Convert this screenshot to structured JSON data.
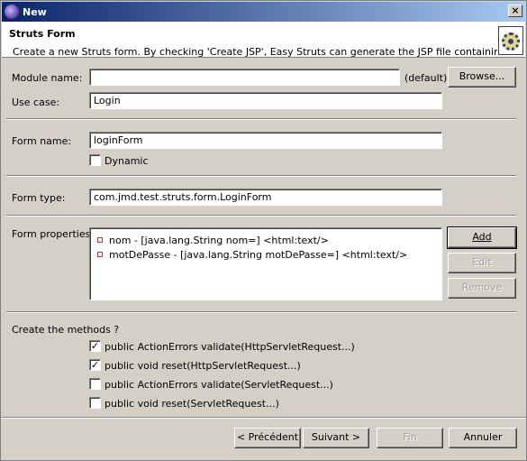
{
  "window": {
    "title": "New",
    "close_glyph": "×",
    "icon": "eclipse-icon"
  },
  "header": {
    "title": "Struts Form",
    "description": "Create a new Struts form. By checking 'Create JSP', Easy Struts can generate the JSP file containing the form",
    "icon": "gear-icon"
  },
  "form": {
    "module_name": {
      "label": "Module name:",
      "value": "",
      "suffix": "(default)"
    },
    "browse_label": "Browse...",
    "use_case": {
      "label": "Use case:",
      "value": "Login"
    },
    "form_name": {
      "label": "Form name:",
      "value": "loginForm"
    },
    "dynamic": {
      "label": "Dynamic",
      "checked": false
    },
    "form_type": {
      "label": "Form type:",
      "value": "com.jmd.test.struts.form.LoginForm"
    },
    "properties": {
      "label": "Form properties:",
      "items": [
        "nom - [java.lang.String nom=] <html:text/>",
        "motDePasse - [java.lang.String motDePasse=] <html:text/>"
      ],
      "add_label": "Add",
      "edit_label": "Edit",
      "remove_label": "Remove"
    }
  },
  "methods": {
    "label": "Create the methods ?",
    "items": [
      {
        "label": "public ActionErrors validate(HttpServletRequest...)",
        "checked": true
      },
      {
        "label": "public void reset(HttpServletRequest...)",
        "checked": true
      },
      {
        "label": "public ActionErrors validate(ServletRequest...)",
        "checked": false
      },
      {
        "label": "public void reset(ServletRequest...)",
        "checked": false
      }
    ]
  },
  "footer": {
    "back_label": "< Précédent",
    "next_label": "Suivant >",
    "finish_label": "Fin",
    "cancel_label": "Annuler"
  },
  "colors": {
    "titlebar_start": "#0a246a",
    "titlebar_end": "#a6caf0",
    "dialog_bg": "#d4d0c8",
    "bullet": "#c03030"
  }
}
